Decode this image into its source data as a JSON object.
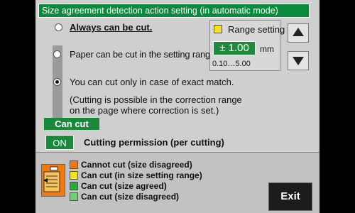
{
  "title": "Size agreement detection action setting (in automatic mode)",
  "options": [
    {
      "label": "Always can be cut.",
      "selected": false
    },
    {
      "label": "Paper can be cut in the setting range",
      "selected": false
    },
    {
      "label": "You can cut only in case of exact match.",
      "selected": true
    }
  ],
  "exact_match_note_1": "(Cutting is possible in the correction range",
  "exact_match_note_2": "on the page where correction is set.)",
  "range_setting": {
    "label": "Range setting",
    "value": "± 1.00",
    "unit": "mm",
    "range_hint": "0.10…5.00",
    "up_icon": "arrow-up-icon",
    "down_icon": "arrow-down-icon"
  },
  "can_cut_label": "Can cut",
  "cutting_permission": {
    "toggle_label": "ON",
    "label": "Cutting permission (per cutting)"
  },
  "legend": [
    {
      "label": "Cannot cut (size disagreed)",
      "color": "#f07a10"
    },
    {
      "label": "Can cut (in size setting range)",
      "color": "#f4e21a"
    },
    {
      "label": "Can cut (size agreed)",
      "color": "#28a838"
    },
    {
      "label": "Can cut (size disagreed)",
      "color": "#6fcf72"
    }
  ],
  "legend_icon": "cutting-status-icon",
  "exit_label": "Exit"
}
